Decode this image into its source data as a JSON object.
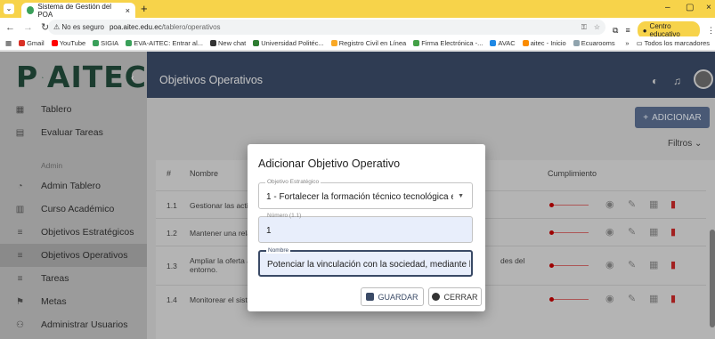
{
  "browser": {
    "tab_title": "Sistema de Gestión del POA",
    "tab_close": "×",
    "new_tab": "+",
    "url_security": "⚠ No es seguro",
    "url_host": "poa.aitec.edu.ec",
    "url_path": "/tablero/operativos",
    "profile_label": "Centro educativo",
    "bookmarks": [
      "Gmail",
      "YouTube",
      "SIGIA",
      "EVA-AITEC: Entrar al...",
      "New chat",
      "Universidad Politéc...",
      "Registro Civil en Línea",
      "Firma Electrónica -...",
      "AVAC",
      "aitec - Inicio",
      "Ecuarooms"
    ],
    "bookmarks_more": "»",
    "all_bookmarks": "Todos los marcadores"
  },
  "sidebar": {
    "logo_text_left": "P",
    "logo_text_right": "AITEC",
    "items": [
      {
        "label": "Tablero",
        "icon": "dashboard-icon"
      },
      {
        "label": "Evaluar Tareas",
        "icon": "clipboard-icon"
      }
    ],
    "section_label": "Admin",
    "admin_items": [
      {
        "label": "Admin Tablero",
        "icon": "gauge-icon"
      },
      {
        "label": "Curso Académico",
        "icon": "book-icon"
      },
      {
        "label": "Objetivos Estratégicos",
        "icon": "list-icon"
      },
      {
        "label": "Objetivos Operativos",
        "icon": "list-icon"
      },
      {
        "label": "Tareas",
        "icon": "list-icon"
      },
      {
        "label": "Metas",
        "icon": "flag-icon"
      },
      {
        "label": "Administrar Usuarios",
        "icon": "users-icon"
      }
    ]
  },
  "header": {
    "title": "Objetivos Operativos"
  },
  "toolbar": {
    "add_label": "ADICIONAR",
    "filters_label": "Filtros"
  },
  "table": {
    "columns": [
      "#",
      "Nombre",
      "Cumplimiento"
    ],
    "rows": [
      {
        "num": "1.1",
        "name": "Gestionar las activi",
        "tail": ""
      },
      {
        "num": "1.2",
        "name": "Mantener una relac",
        "tail": ""
      },
      {
        "num": "1.3",
        "name": "Ampliar la oferta ac",
        "name2": "entorno.",
        "tail": "des del"
      },
      {
        "num": "1.4",
        "name": "Monitorear el sistema de evaluación con el propósito de hacer correcciones",
        "tail": ""
      }
    ]
  },
  "dialog": {
    "title": "Adicionar Objetivo Operativo",
    "objetivo_label": "Objetivo Estratégico",
    "objetivo_value": "1 - Fortalecer la formación técnico tecnológica en...",
    "numero_label": "Número (1.1)",
    "numero_value": "1",
    "nombre_label": "Nombre",
    "nombre_value": "Potenciar la vinculación con la sociedad, mediante la implem",
    "save_label": "GUARDAR",
    "close_label": "CERRAR"
  },
  "colors": {
    "topbar": "#3a4a66",
    "accent": "#5a6d8f",
    "danger": "#c62828",
    "browser_frame": "#f7d34a"
  }
}
